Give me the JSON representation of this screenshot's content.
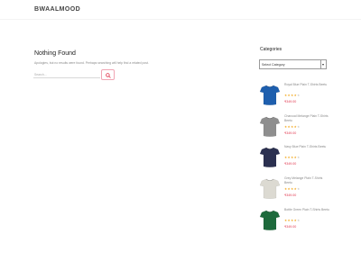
{
  "header": {
    "logo": "BWAALMOOD"
  },
  "main": {
    "title": "Nothing Found",
    "message": "Apologies, but no results were found. Perhaps searching will help find a related post.",
    "search": {
      "placeholder": "Search..."
    }
  },
  "sidebar": {
    "categories_title": "Categories",
    "select_value": "Select Category",
    "products": [
      {
        "name": "Royal Blue Plain T-Shirts Beetu",
        "price": "₹349.00",
        "rating": 4,
        "color": "#1e5fae"
      },
      {
        "name": "Charcoal Melange Plain T-Shirts Beetu",
        "price": "₹349.00",
        "rating": 4,
        "color": "#8e8e8e"
      },
      {
        "name": "Navy Blue Plain T-Shirts Beetu",
        "price": "₹349.00",
        "rating": 4,
        "color": "#2b3050"
      },
      {
        "name": "Grey Melange Plain T-Shirts Beetu",
        "price": "₹349.00",
        "rating": 4,
        "color": "#dcdad2"
      },
      {
        "name": "Bottle Green Plain T-Shirts Beetu",
        "price": "₹349.00",
        "rating": 4,
        "color": "#1e6a3c"
      }
    ]
  }
}
